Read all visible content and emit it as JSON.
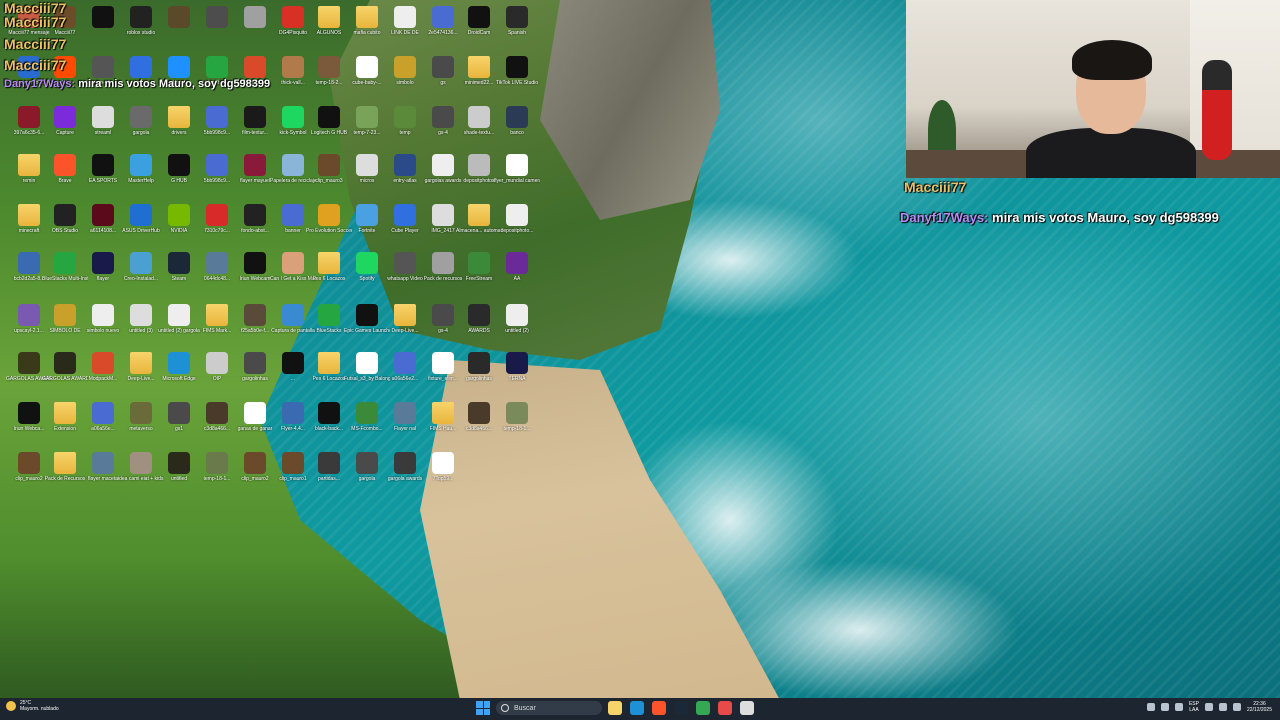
{
  "desktop": {
    "icons": [
      {
        "label": "Macciii77 mensaje",
        "kind": "app",
        "color": "#c75c43"
      },
      {
        "label": "Macciii77",
        "kind": "app",
        "color": "#6d4c2a"
      },
      {
        "label": "",
        "kind": "app",
        "color": "#111111"
      },
      {
        "label": "roblox studio",
        "kind": "app",
        "color": "#222222"
      },
      {
        "label": "",
        "kind": "app",
        "color": "#5a4a2a"
      },
      {
        "label": "",
        "kind": "app",
        "color": "#4d4d4d"
      },
      {
        "label": "",
        "kind": "app",
        "color": "#a0a0a0"
      },
      {
        "label": "DG4Pisquito",
        "kind": "pdf",
        "color": "#d93025"
      },
      {
        "label": "ALGUNOS",
        "kind": "folder",
        "color": "#e8b53c"
      },
      {
        "label": "mafia cubito",
        "kind": "folder",
        "color": "#e8b53c"
      },
      {
        "label": "LINK DE DE",
        "kind": "app",
        "color": "#eeeeee"
      },
      {
        "label": "2e5474136...",
        "kind": "app",
        "color": "#4a6bd1"
      },
      {
        "label": "DroidCam",
        "kind": "app",
        "color": "#111111"
      },
      {
        "label": "Spanish",
        "kind": "app",
        "color": "#2a2a2a"
      },
      {
        "label": "mira mis votos",
        "kind": "app",
        "color": "#2a6bd1"
      },
      {
        "label": "EA",
        "kind": "app",
        "color": "#ff4a00"
      },
      {
        "label": "temp-19...",
        "kind": "app",
        "color": "#555555"
      },
      {
        "label": "fortnite",
        "kind": "app",
        "color": "#2f6fe0"
      },
      {
        "label": "Uscol",
        "kind": "app",
        "color": "#1e90ff"
      },
      {
        "label": "BlueStacks",
        "kind": "app",
        "color": "#26a641"
      },
      {
        "label": "Extension",
        "kind": "app",
        "color": "#d94a2b"
      },
      {
        "label": "thick-vall...",
        "kind": "app",
        "color": "#b07a4a"
      },
      {
        "label": "temp-18-2...",
        "kind": "app",
        "color": "#7a5a3a"
      },
      {
        "label": "cube-baby-...",
        "kind": "app",
        "color": "#ffffff"
      },
      {
        "label": "simbolo",
        "kind": "app",
        "color": "#c8a02a"
      },
      {
        "label": "gs",
        "kind": "app",
        "color": "#4a4a4a"
      },
      {
        "label": "minimed22...",
        "kind": "folder",
        "color": "#e8b53c"
      },
      {
        "label": "TikTok LIVE Studio",
        "kind": "app",
        "color": "#111111"
      },
      {
        "label": "397a6c35-6...",
        "kind": "app",
        "color": "#8a1a2a"
      },
      {
        "label": "Capture",
        "kind": "app",
        "color": "#7b2bd9"
      },
      {
        "label": "streaml",
        "kind": "app",
        "color": "#dddddd"
      },
      {
        "label": "gargola",
        "kind": "app",
        "color": "#6a6a6a"
      },
      {
        "label": "drivers",
        "kind": "folder",
        "color": "#e8b53c"
      },
      {
        "label": "5bb998c9...",
        "kind": "app",
        "color": "#4a6bd1"
      },
      {
        "label": "film-textur...",
        "kind": "app",
        "color": "#1a1a1a"
      },
      {
        "label": "kick-Symbol",
        "kind": "app",
        "color": "#1ed760"
      },
      {
        "label": "Logitech G HUB",
        "kind": "app",
        "color": "#111111"
      },
      {
        "label": "temp-7-23...",
        "kind": "app",
        "color": "#7aa35a"
      },
      {
        "label": "temp",
        "kind": "app",
        "color": "#5a8a3a"
      },
      {
        "label": "gs-4",
        "kind": "app",
        "color": "#4a4a4a"
      },
      {
        "label": "shade-textu...",
        "kind": "app",
        "color": "#cccccc"
      },
      {
        "label": "banco",
        "kind": "app",
        "color": "#2b3a55"
      },
      {
        "label": "remin",
        "kind": "folder",
        "color": "#e8b53c"
      },
      {
        "label": "Brave",
        "kind": "app",
        "color": "#fb542b"
      },
      {
        "label": "EA SPORTS",
        "kind": "app",
        "color": "#111111"
      },
      {
        "label": "MasterHelp",
        "kind": "app",
        "color": "#3aa0e0"
      },
      {
        "label": "G HUB",
        "kind": "app",
        "color": "#111111"
      },
      {
        "label": "5bb998c9...",
        "kind": "app",
        "color": "#4a6bd1"
      },
      {
        "label": "flayer mayuel",
        "kind": "app",
        "color": "#8a1a3a"
      },
      {
        "label": "Papelera de reciclaje",
        "kind": "app",
        "color": "#8ab4d8"
      },
      {
        "label": "clip_mauro3",
        "kind": "app",
        "color": "#6a4a2a"
      },
      {
        "label": "micros",
        "kind": "app",
        "color": "#dddddd"
      },
      {
        "label": "entry-atlas",
        "kind": "app",
        "color": "#2a4a8a"
      },
      {
        "label": "gargolas awards",
        "kind": "app",
        "color": "#eeeeee"
      },
      {
        "label": "depositphotos",
        "kind": "app",
        "color": "#bbbbbb"
      },
      {
        "label": "flyer_mundial camera",
        "kind": "app",
        "color": "#ffffff"
      },
      {
        "label": "minecraft",
        "kind": "folder",
        "color": "#e8b53c"
      },
      {
        "label": "OBS Studio",
        "kind": "app",
        "color": "#222222"
      },
      {
        "label": "a6114108...",
        "kind": "app",
        "color": "#5a0a1a"
      },
      {
        "label": "ASUS DriverHub",
        "kind": "app",
        "color": "#1e6fd1"
      },
      {
        "label": "NVIDIA",
        "kind": "app",
        "color": "#76b900"
      },
      {
        "label": "7310c79c...",
        "kind": "app",
        "color": "#d92a2a"
      },
      {
        "label": "fondo-abst...",
        "kind": "app",
        "color": "#222222"
      },
      {
        "label": "banner",
        "kind": "app",
        "color": "#4a6bd1"
      },
      {
        "label": "Pro Evolution Soccer",
        "kind": "app",
        "color": "#e0a020"
      },
      {
        "label": "Fortnite",
        "kind": "app",
        "color": "#4aa0e0"
      },
      {
        "label": "Cube Player",
        "kind": "app",
        "color": "#2f6fe0"
      },
      {
        "label": "IMG_2417",
        "kind": "app",
        "color": "#dddddd"
      },
      {
        "label": "Almacena... automatic...",
        "kind": "folder",
        "color": "#e8b53c"
      },
      {
        "label": "depositphoto...",
        "kind": "app",
        "color": "#eeeeee"
      },
      {
        "label": "bcb2d2a5-8...",
        "kind": "app",
        "color": "#3a6ab1"
      },
      {
        "label": "BlueStacks Multi-Instan...",
        "kind": "app",
        "color": "#26a641"
      },
      {
        "label": "flayer",
        "kind": "app",
        "color": "#1a1a4a"
      },
      {
        "label": "Creo-Instalad...",
        "kind": "app",
        "color": "#4aa0d0"
      },
      {
        "label": "Steam",
        "kind": "app",
        "color": "#1b2838"
      },
      {
        "label": "0644dc48...",
        "kind": "app",
        "color": "#5a7a9a"
      },
      {
        "label": "Iriun Webcam",
        "kind": "app",
        "color": "#111111"
      },
      {
        "label": "Can I Get a Kiss Mauroo",
        "kind": "app",
        "color": "#d9a07a"
      },
      {
        "label": "Pes 6 Locazos",
        "kind": "folder",
        "color": "#e8b53c"
      },
      {
        "label": "Spotify",
        "kind": "app",
        "color": "#1ed760"
      },
      {
        "label": "whatsapp Video",
        "kind": "app",
        "color": "#555555"
      },
      {
        "label": "Pack de recursos",
        "kind": "app",
        "color": "#a0a0a0"
      },
      {
        "label": "FreeStream",
        "kind": "app",
        "color": "#3a8a3a"
      },
      {
        "label": "AA",
        "kind": "app",
        "color": "#6a2a9a"
      },
      {
        "label": "upscayl-2.1...",
        "kind": "app",
        "color": "#7a5ab1"
      },
      {
        "label": "SIMBOLO DE",
        "kind": "app",
        "color": "#c8a02a"
      },
      {
        "label": "simbolo nuevo",
        "kind": "app",
        "color": "#eeeeee"
      },
      {
        "label": "untitled (3)",
        "kind": "app",
        "color": "#dddddd"
      },
      {
        "label": "untitled (2) gargola",
        "kind": "app",
        "color": "#eeeeee"
      },
      {
        "label": "FIMS Mark...",
        "kind": "folder",
        "color": "#e8b53c"
      },
      {
        "label": "f25a5b0e-f...",
        "kind": "app",
        "color": "#5a4a3a"
      },
      {
        "label": "Captura de pantalla",
        "kind": "app",
        "color": "#3a8ad1"
      },
      {
        "label": "BlueStacks",
        "kind": "app",
        "color": "#26a641"
      },
      {
        "label": "Epic Games Launcher",
        "kind": "app",
        "color": "#111111"
      },
      {
        "label": "Deep-Live...",
        "kind": "folder",
        "color": "#e8b53c"
      },
      {
        "label": "gs-4",
        "kind": "app",
        "color": "#4a4a4a"
      },
      {
        "label": "AWARDS",
        "kind": "app",
        "color": "#2a2a2a"
      },
      {
        "label": "untitled (2)",
        "kind": "app",
        "color": "#eeeeee"
      },
      {
        "label": "GARGOLAS AWARDS",
        "kind": "app",
        "color": "#3a3a1a"
      },
      {
        "label": "GARGOLAS AWARDS",
        "kind": "app",
        "color": "#2a2a1a"
      },
      {
        "label": "ModpackM...",
        "kind": "app",
        "color": "#d94a2a"
      },
      {
        "label": "Deep-Live...",
        "kind": "folder",
        "color": "#e8b53c"
      },
      {
        "label": "Microsoft Edge",
        "kind": "app",
        "color": "#1e90d6"
      },
      {
        "label": "OIP",
        "kind": "app",
        "color": "#cccccc"
      },
      {
        "label": "gargolinhas",
        "kind": "app",
        "color": "#4a4a4a"
      },
      {
        "label": "...",
        "kind": "app",
        "color": "#111111"
      },
      {
        "label": "Pes 6 Locazos",
        "kind": "folder",
        "color": "#e8b53c"
      },
      {
        "label": "Futsal_s3_by Balonga Fm",
        "kind": "app",
        "color": "#ffffff"
      },
      {
        "label": "a06a56e2...",
        "kind": "app",
        "color": "#4a6bd1"
      },
      {
        "label": "fixture_elim...",
        "kind": "app",
        "color": "#ffffff"
      },
      {
        "label": "gargolinhas",
        "kind": "app",
        "color": "#2a2a2a"
      },
      {
        "label": "TERNA",
        "kind": "app",
        "color": "#1a1a4a"
      },
      {
        "label": "Iriun Webca...",
        "kind": "app",
        "color": "#111111"
      },
      {
        "label": "Extension",
        "kind": "folder",
        "color": "#e8b53c"
      },
      {
        "label": "a06a56e...",
        "kind": "app",
        "color": "#4a6bd1"
      },
      {
        "label": "metaverso",
        "kind": "app",
        "color": "#6a6a3a"
      },
      {
        "label": "gs1",
        "kind": "app",
        "color": "#4a4a4a"
      },
      {
        "label": "c3d8a466...",
        "kind": "app",
        "color": "#4a3a2a"
      },
      {
        "label": "ganas de ganar",
        "kind": "app",
        "color": "#ffffff"
      },
      {
        "label": "Flyer-4.4...",
        "kind": "app",
        "color": "#3a6ab1"
      },
      {
        "label": "black-back...",
        "kind": "app",
        "color": "#111111"
      },
      {
        "label": "MS-Fcombo...",
        "kind": "app",
        "color": "#3a8a3a"
      },
      {
        "label": "Flayer nal",
        "kind": "app",
        "color": "#5a7a9a"
      },
      {
        "label": "FIMS Hau...",
        "kind": "folder",
        "color": "#e8b53c"
      },
      {
        "label": "c3d8a466...",
        "kind": "app",
        "color": "#4a3a2a"
      },
      {
        "label": "temp-18-1...",
        "kind": "app",
        "color": "#7a8a5a"
      },
      {
        "label": "clip_mauro2",
        "kind": "app",
        "color": "#6a4a2a"
      },
      {
        "label": "Pack de Recursos",
        "kind": "folder",
        "color": "#e8b53c"
      },
      {
        "label": "flayer maceta",
        "kind": "app",
        "color": "#5a7a9a"
      },
      {
        "label": "idea cami eiat + kids mauri...",
        "kind": "app",
        "color": "#a09080"
      },
      {
        "label": "untitled",
        "kind": "app",
        "color": "#2a2a1a"
      },
      {
        "label": "temp-18-1...",
        "kind": "app",
        "color": "#6a7a4a"
      },
      {
        "label": "clip_mauro2",
        "kind": "app",
        "color": "#6a4a2a"
      },
      {
        "label": "clip_mauro1",
        "kind": "app",
        "color": "#6a4a2a"
      },
      {
        "label": "partidas...",
        "kind": "app",
        "color": "#3a3a3a"
      },
      {
        "label": "gargola",
        "kind": "app",
        "color": "#4a4a4a"
      },
      {
        "label": "gargola awards",
        "kind": "app",
        "color": "#3a3a3a"
      },
      {
        "label": "7Top59...",
        "kind": "app",
        "color": "#ffffff"
      }
    ]
  },
  "chat": {
    "left_top": [
      {
        "name": "Macciii77",
        "msg": ""
      },
      {
        "name": "Macciii77",
        "msg": ""
      },
      {
        "name": "Macciii77",
        "msg": ""
      },
      {
        "name": "Macciii77",
        "msg": ""
      },
      {
        "name": "Dany17Ways:",
        "msg": "mira mis votos Mauro, soy dg598399"
      }
    ],
    "right": [
      {
        "name": "Macciii77",
        "msg": ""
      },
      {
        "name": "Danyf17Ways:",
        "msg": "mira mis votos Mauro, soy dg598399"
      }
    ]
  },
  "taskbar": {
    "weather_temp": "25°C",
    "weather_desc": "Mayorm. nublado",
    "search_placeholder": "Buscar",
    "lang_top": "ESP",
    "lang_bottom": "LAA",
    "time": "22:36",
    "date": "22/12/2025",
    "apps": [
      {
        "name": "file-explorer-icon",
        "color": "#f7d46a"
      },
      {
        "name": "edge-icon",
        "color": "#1e90d6"
      },
      {
        "name": "brave-icon",
        "color": "#fb542b"
      },
      {
        "name": "steam-icon",
        "color": "#1b2838"
      },
      {
        "name": "chrome-icon",
        "color": "#34a853"
      },
      {
        "name": "obs-icon",
        "color": "#e84a4a"
      },
      {
        "name": "notes-icon",
        "color": "#dddddd"
      }
    ]
  }
}
